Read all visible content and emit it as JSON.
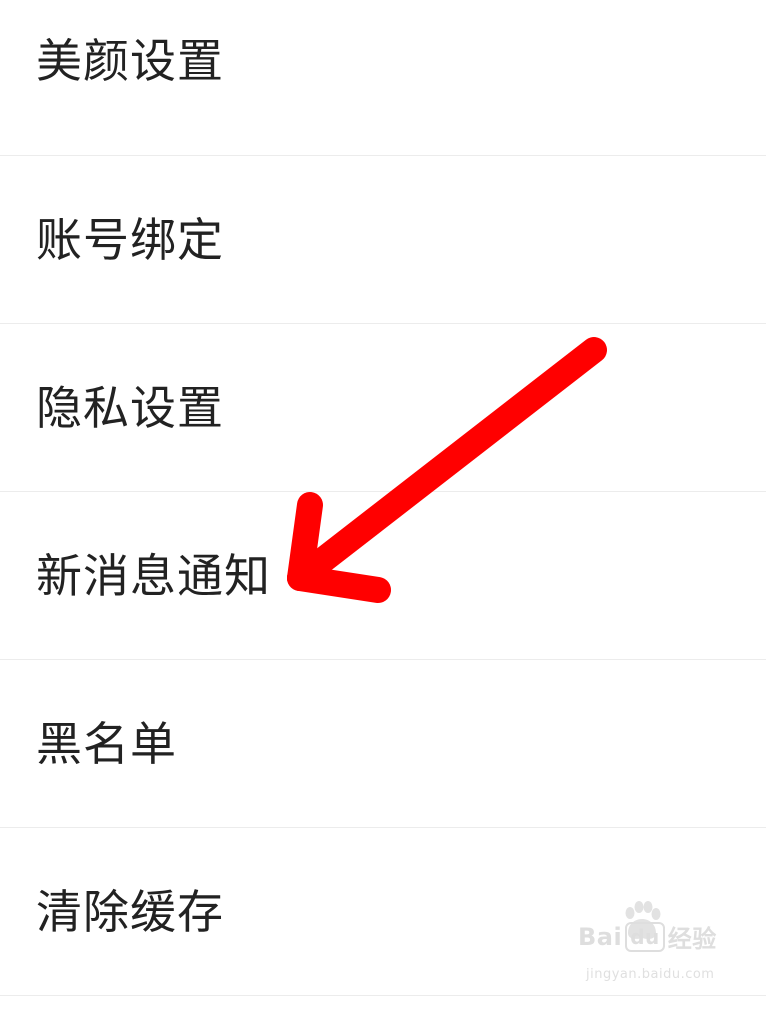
{
  "settings": {
    "items": [
      {
        "label": "美颜设置"
      },
      {
        "label": "账号绑定"
      },
      {
        "label": "隐私设置"
      },
      {
        "label": "新消息通知"
      },
      {
        "label": "黑名单"
      },
      {
        "label": "清除缓存"
      }
    ]
  },
  "annotation": {
    "arrow_color": "#ff0000",
    "points_to": "新消息通知"
  },
  "watermark": {
    "brand_prefix": "Bai",
    "brand_du": "du",
    "brand_suffix": "经验",
    "url": "jingyan.baidu.com"
  },
  "colors": {
    "background": "#ffffff",
    "text": "#222222",
    "divider": "#ececec"
  }
}
